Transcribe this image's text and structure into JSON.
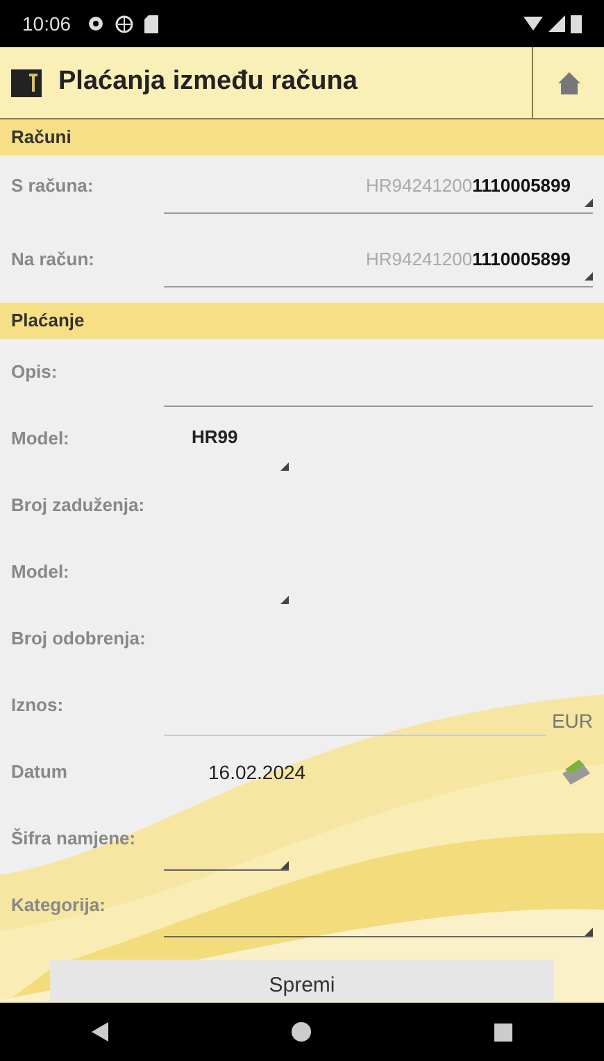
{
  "status_bar": {
    "time": "10:06"
  },
  "header": {
    "title": "Plaćanja između računa"
  },
  "sections": [
    {
      "title": "Računi",
      "fields": [
        {
          "kind": "account",
          "label": "S računa:",
          "prefix": "HR94241200",
          "suffix": "1110005899"
        },
        {
          "kind": "account",
          "label": "Na račun:",
          "prefix": "HR94241200",
          "suffix": "1110005899"
        }
      ]
    },
    {
      "title": "Plaćanje",
      "fields": [
        {
          "kind": "text",
          "label": "Opis:"
        },
        {
          "kind": "dropdown",
          "label": "Model:",
          "value": "HR99"
        },
        {
          "kind": "text",
          "label": "Broj zaduženja:"
        },
        {
          "kind": "dropdown",
          "label": "Model:"
        },
        {
          "kind": "text",
          "label": "Broj odobrenja:"
        },
        {
          "kind": "amount",
          "label": "Iznos:",
          "currency": "EUR"
        },
        {
          "kind": "date",
          "label": "Datum",
          "value": "16.02.2024"
        },
        {
          "kind": "select",
          "label": "Šifra namjene:"
        },
        {
          "kind": "wide_select",
          "label": "Kategorija:"
        }
      ]
    }
  ],
  "save_button": "Spremi"
}
